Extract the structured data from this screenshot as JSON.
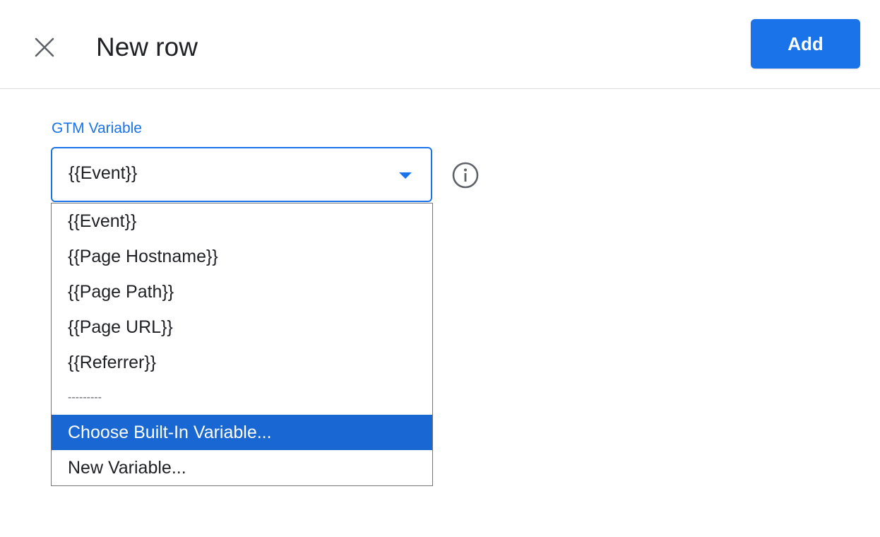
{
  "header": {
    "close_icon": "close-icon",
    "title": "New row",
    "add_label": "Add"
  },
  "field": {
    "label": "GTM Variable",
    "value": "{{Event}}",
    "info_icon": "info-icon",
    "accent_color": "#1a73e8"
  },
  "dropdown": {
    "selected_index": 6,
    "selected_color": "#1967d2",
    "options": [
      {
        "label": "{{Event}}"
      },
      {
        "label": "{{Page Hostname}}"
      },
      {
        "label": "{{Page Path}}"
      },
      {
        "label": "{{Page URL}}"
      },
      {
        "label": "{{Referrer}}"
      },
      {
        "label": "---------"
      },
      {
        "label": "Choose Built-In Variable..."
      },
      {
        "label": "New Variable..."
      }
    ]
  }
}
